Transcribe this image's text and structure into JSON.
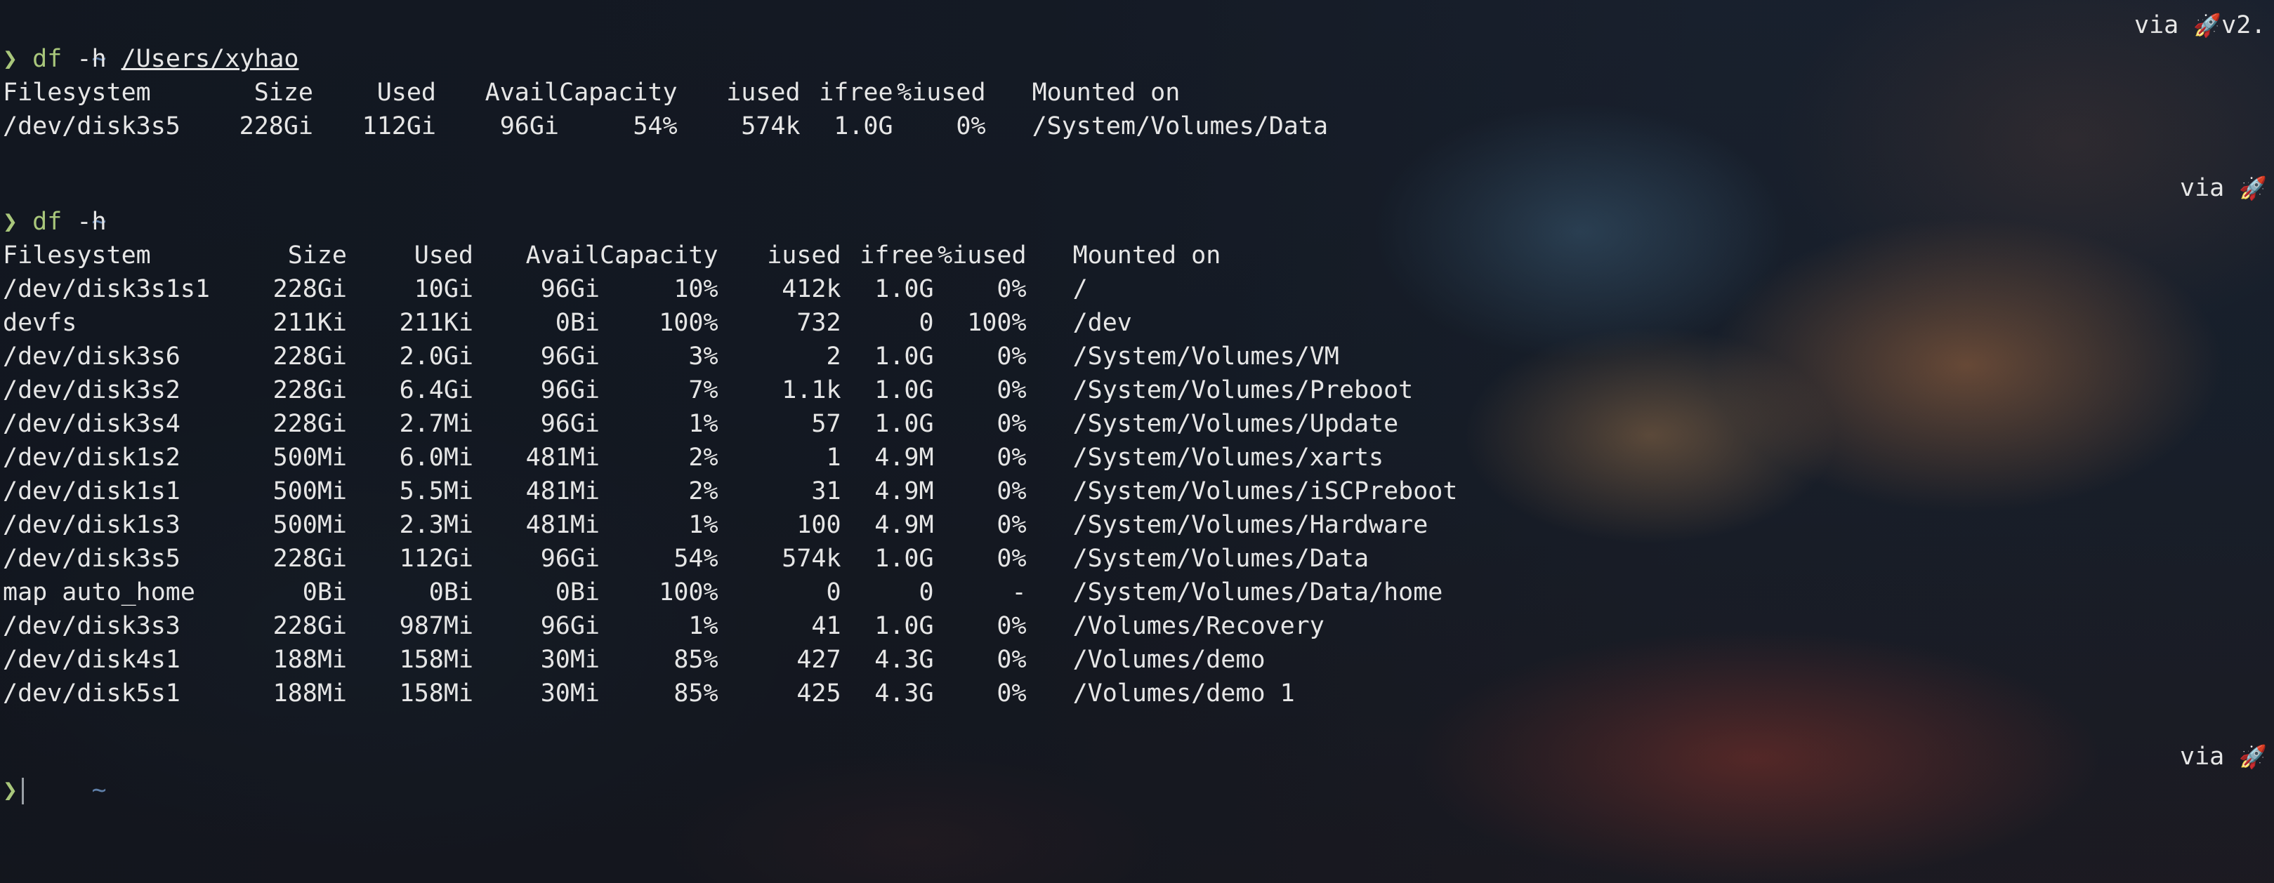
{
  "blocks": [
    {
      "cwd": "~",
      "prompt_symbol": "❯",
      "command": "df",
      "flags": "-h",
      "path_arg": "/Users/xyhao",
      "right_status": "via",
      "right_version": "v2.",
      "headers": [
        "Filesystem",
        "Size",
        "Used",
        "Avail",
        "Capacity",
        "iused",
        "ifree",
        "%iused",
        "Mounted on"
      ],
      "rows": [
        [
          "/dev/disk3s5",
          "228Gi",
          "112Gi",
          "96Gi",
          "54%",
          "574k",
          "1.0G",
          "0%",
          "/System/Volumes/Data"
        ]
      ]
    },
    {
      "cwd": "~",
      "prompt_symbol": "❯",
      "command": "df",
      "flags": "-h",
      "right_status": "via",
      "headers": [
        "Filesystem",
        "Size",
        "Used",
        "Avail",
        "Capacity",
        "iused",
        "ifree",
        "%iused",
        "Mounted on"
      ],
      "rows": [
        [
          "/dev/disk3s1s1",
          "228Gi",
          "10Gi",
          "96Gi",
          "10%",
          "412k",
          "1.0G",
          "0%",
          "/"
        ],
        [
          "devfs",
          "211Ki",
          "211Ki",
          "0Bi",
          "100%",
          "732",
          "0",
          "100%",
          "/dev"
        ],
        [
          "/dev/disk3s6",
          "228Gi",
          "2.0Gi",
          "96Gi",
          "3%",
          "2",
          "1.0G",
          "0%",
          "/System/Volumes/VM"
        ],
        [
          "/dev/disk3s2",
          "228Gi",
          "6.4Gi",
          "96Gi",
          "7%",
          "1.1k",
          "1.0G",
          "0%",
          "/System/Volumes/Preboot"
        ],
        [
          "/dev/disk3s4",
          "228Gi",
          "2.7Mi",
          "96Gi",
          "1%",
          "57",
          "1.0G",
          "0%",
          "/System/Volumes/Update"
        ],
        [
          "/dev/disk1s2",
          "500Mi",
          "6.0Mi",
          "481Mi",
          "2%",
          "1",
          "4.9M",
          "0%",
          "/System/Volumes/xarts"
        ],
        [
          "/dev/disk1s1",
          "500Mi",
          "5.5Mi",
          "481Mi",
          "2%",
          "31",
          "4.9M",
          "0%",
          "/System/Volumes/iSCPreboot"
        ],
        [
          "/dev/disk1s3",
          "500Mi",
          "2.3Mi",
          "481Mi",
          "1%",
          "100",
          "4.9M",
          "0%",
          "/System/Volumes/Hardware"
        ],
        [
          "/dev/disk3s5",
          "228Gi",
          "112Gi",
          "96Gi",
          "54%",
          "574k",
          "1.0G",
          "0%",
          "/System/Volumes/Data"
        ],
        [
          "map auto_home",
          "0Bi",
          "0Bi",
          "0Bi",
          "100%",
          "0",
          "0",
          "-",
          "/System/Volumes/Data/home"
        ],
        [
          "/dev/disk3s3",
          "228Gi",
          "987Mi",
          "96Gi",
          "1%",
          "41",
          "1.0G",
          "0%",
          "/Volumes/Recovery"
        ],
        [
          "/dev/disk4s1",
          "188Mi",
          "158Mi",
          "30Mi",
          "85%",
          "427",
          "4.3G",
          "0%",
          "/Volumes/demo"
        ],
        [
          "/dev/disk5s1",
          "188Mi",
          "158Mi",
          "30Mi",
          "85%",
          "425",
          "4.3G",
          "0%",
          "/Volumes/demo 1"
        ]
      ]
    },
    {
      "cwd": "~",
      "prompt_symbol": "❯",
      "right_status": "via"
    }
  ],
  "icons": {
    "rocket": "rocket-icon"
  },
  "colors": {
    "prompt": "#a9c77b",
    "cwd": "#5f7fa8",
    "text": "#e6e6e6"
  }
}
